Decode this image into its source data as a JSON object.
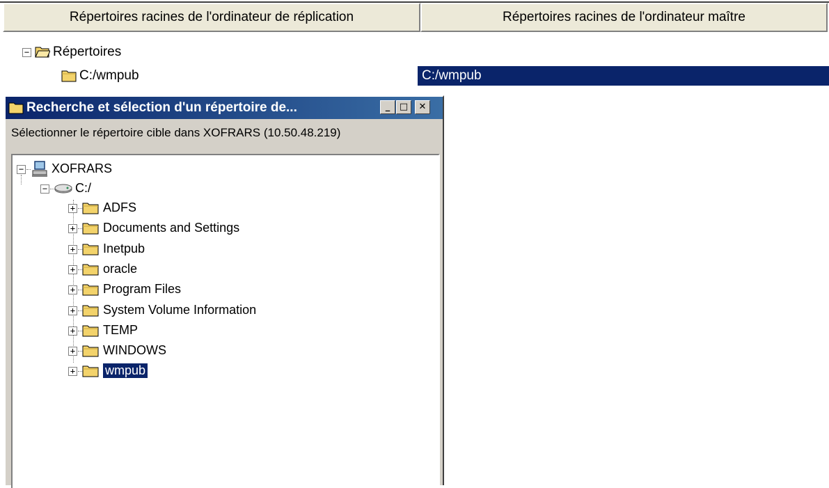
{
  "header": {
    "col1": "Répertoires racines de l'ordinateur de réplication",
    "col2": "Répertoires racines de l'ordinateur maître"
  },
  "outer_tree": {
    "root_label": "Répertoires",
    "root_expander": "−",
    "child_label": "C:/wmpub",
    "child_master_value": "C:/wmpub"
  },
  "dialog": {
    "title": "Recherche et sélection d'un répertoire de...",
    "min_glyph": "_",
    "max_glyph": "□",
    "close_glyph": "✕",
    "subtitle": "Sélectionner le répertoire cible dans XOFRARS (10.50.48.219)",
    "tree": {
      "computer": "XOFRARS",
      "drive": "C:/",
      "collapse_glyph": "−",
      "expand_glyph": "+",
      "folders": [
        "ADFS",
        "Documents and Settings",
        "Inetpub",
        "oracle",
        "Program Files",
        "System Volume Information",
        "TEMP",
        "WINDOWS",
        "wmpub"
      ],
      "selected_folder": "wmpub"
    }
  },
  "colors": {
    "selection": "#0a246a",
    "face": "#d4d0c8",
    "folder": "#f3d36b"
  }
}
